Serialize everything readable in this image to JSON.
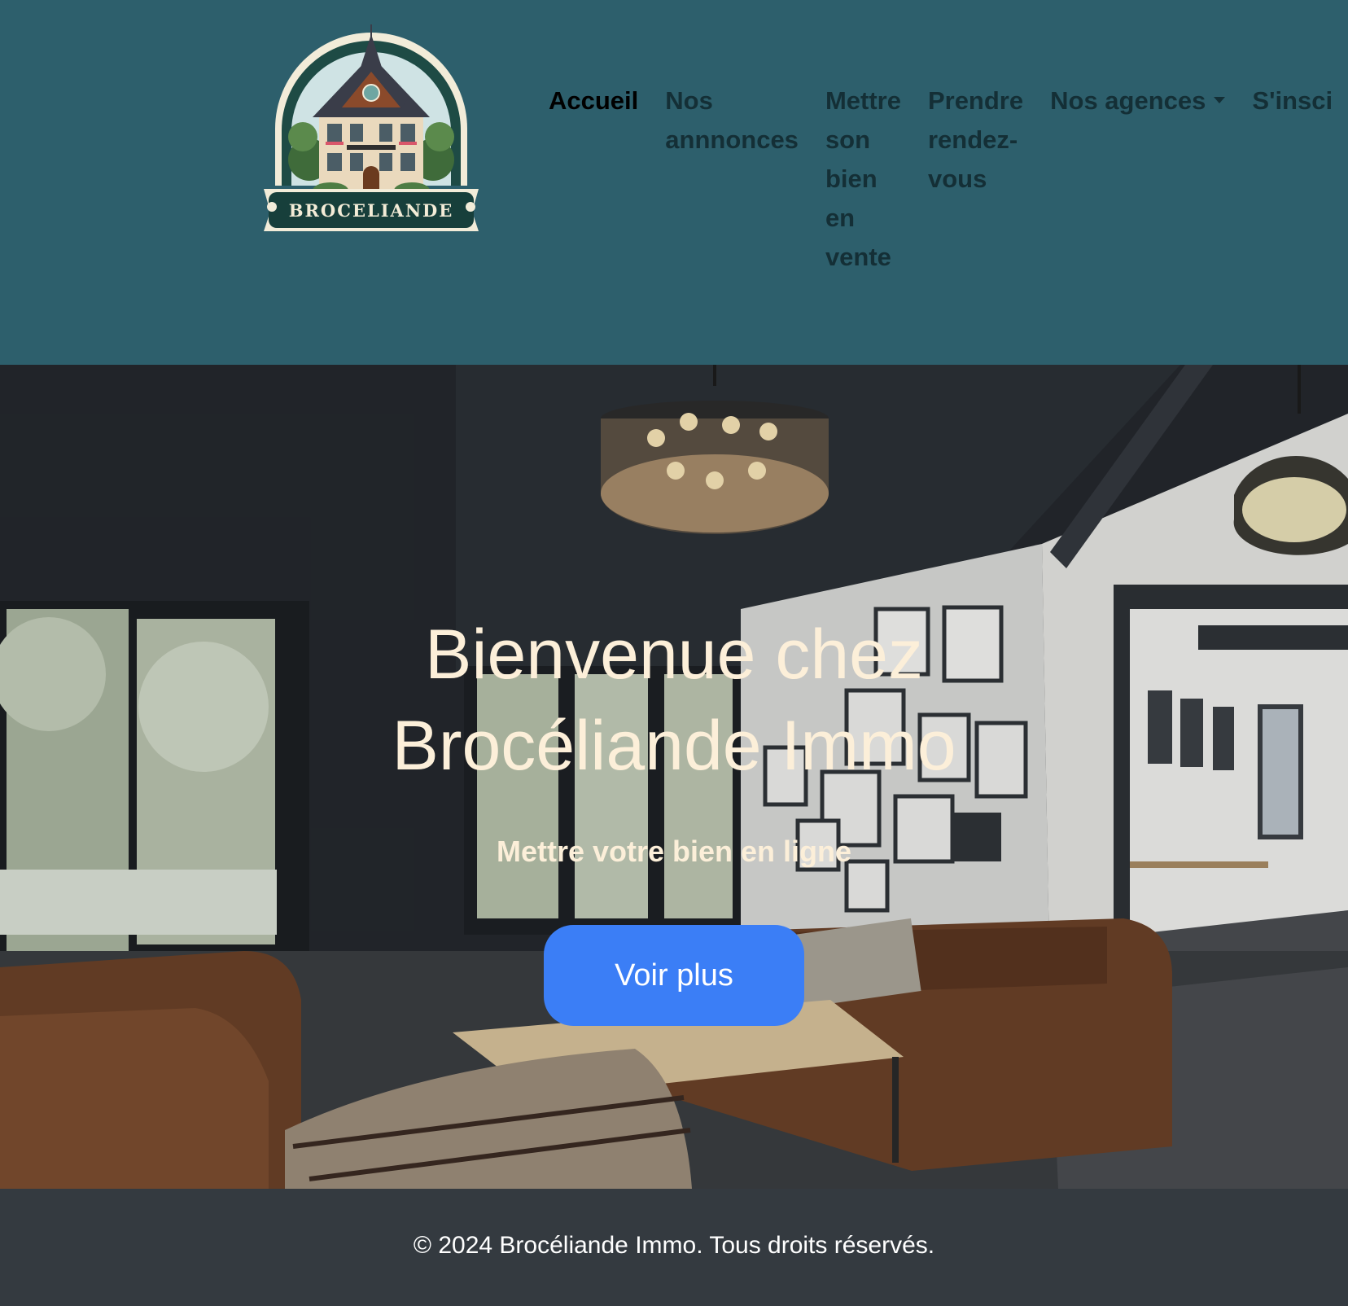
{
  "header": {
    "logo_text": "BROCELIANDE",
    "background_color": "#2d5f6c"
  },
  "nav": {
    "items": [
      {
        "label": "Accueil",
        "lines": [
          "Accueil"
        ],
        "active": true
      },
      {
        "label": "Nos annnonces",
        "lines": [
          "Nos",
          "annnonces"
        ],
        "active": false
      },
      {
        "label": "Mettre son bien en vente",
        "lines": [
          "Mettre",
          "son",
          "bien",
          "en",
          "vente"
        ],
        "active": false
      },
      {
        "label": "Prendre rendez-vous",
        "lines": [
          "Prendre",
          "rendez-",
          "vous"
        ],
        "active": false
      },
      {
        "label": "Nos agences",
        "lines": [
          "Nos agences"
        ],
        "active": false,
        "dropdown": true
      },
      {
        "label": "S'inscrire",
        "lines": [
          "S'insci"
        ],
        "active": false
      }
    ]
  },
  "hero": {
    "title_line1": "Bienvenue chez",
    "title_line2": "Brocéliande Immo",
    "subtitle": "Mettre votre bien en ligne",
    "cta_label": "Voir plus",
    "text_color": "#fcefd9",
    "button_color": "#3b7ef6"
  },
  "footer": {
    "text": "© 2024 Brocéliande Immo. Tous droits réservés.",
    "background_color": "#343a40"
  }
}
